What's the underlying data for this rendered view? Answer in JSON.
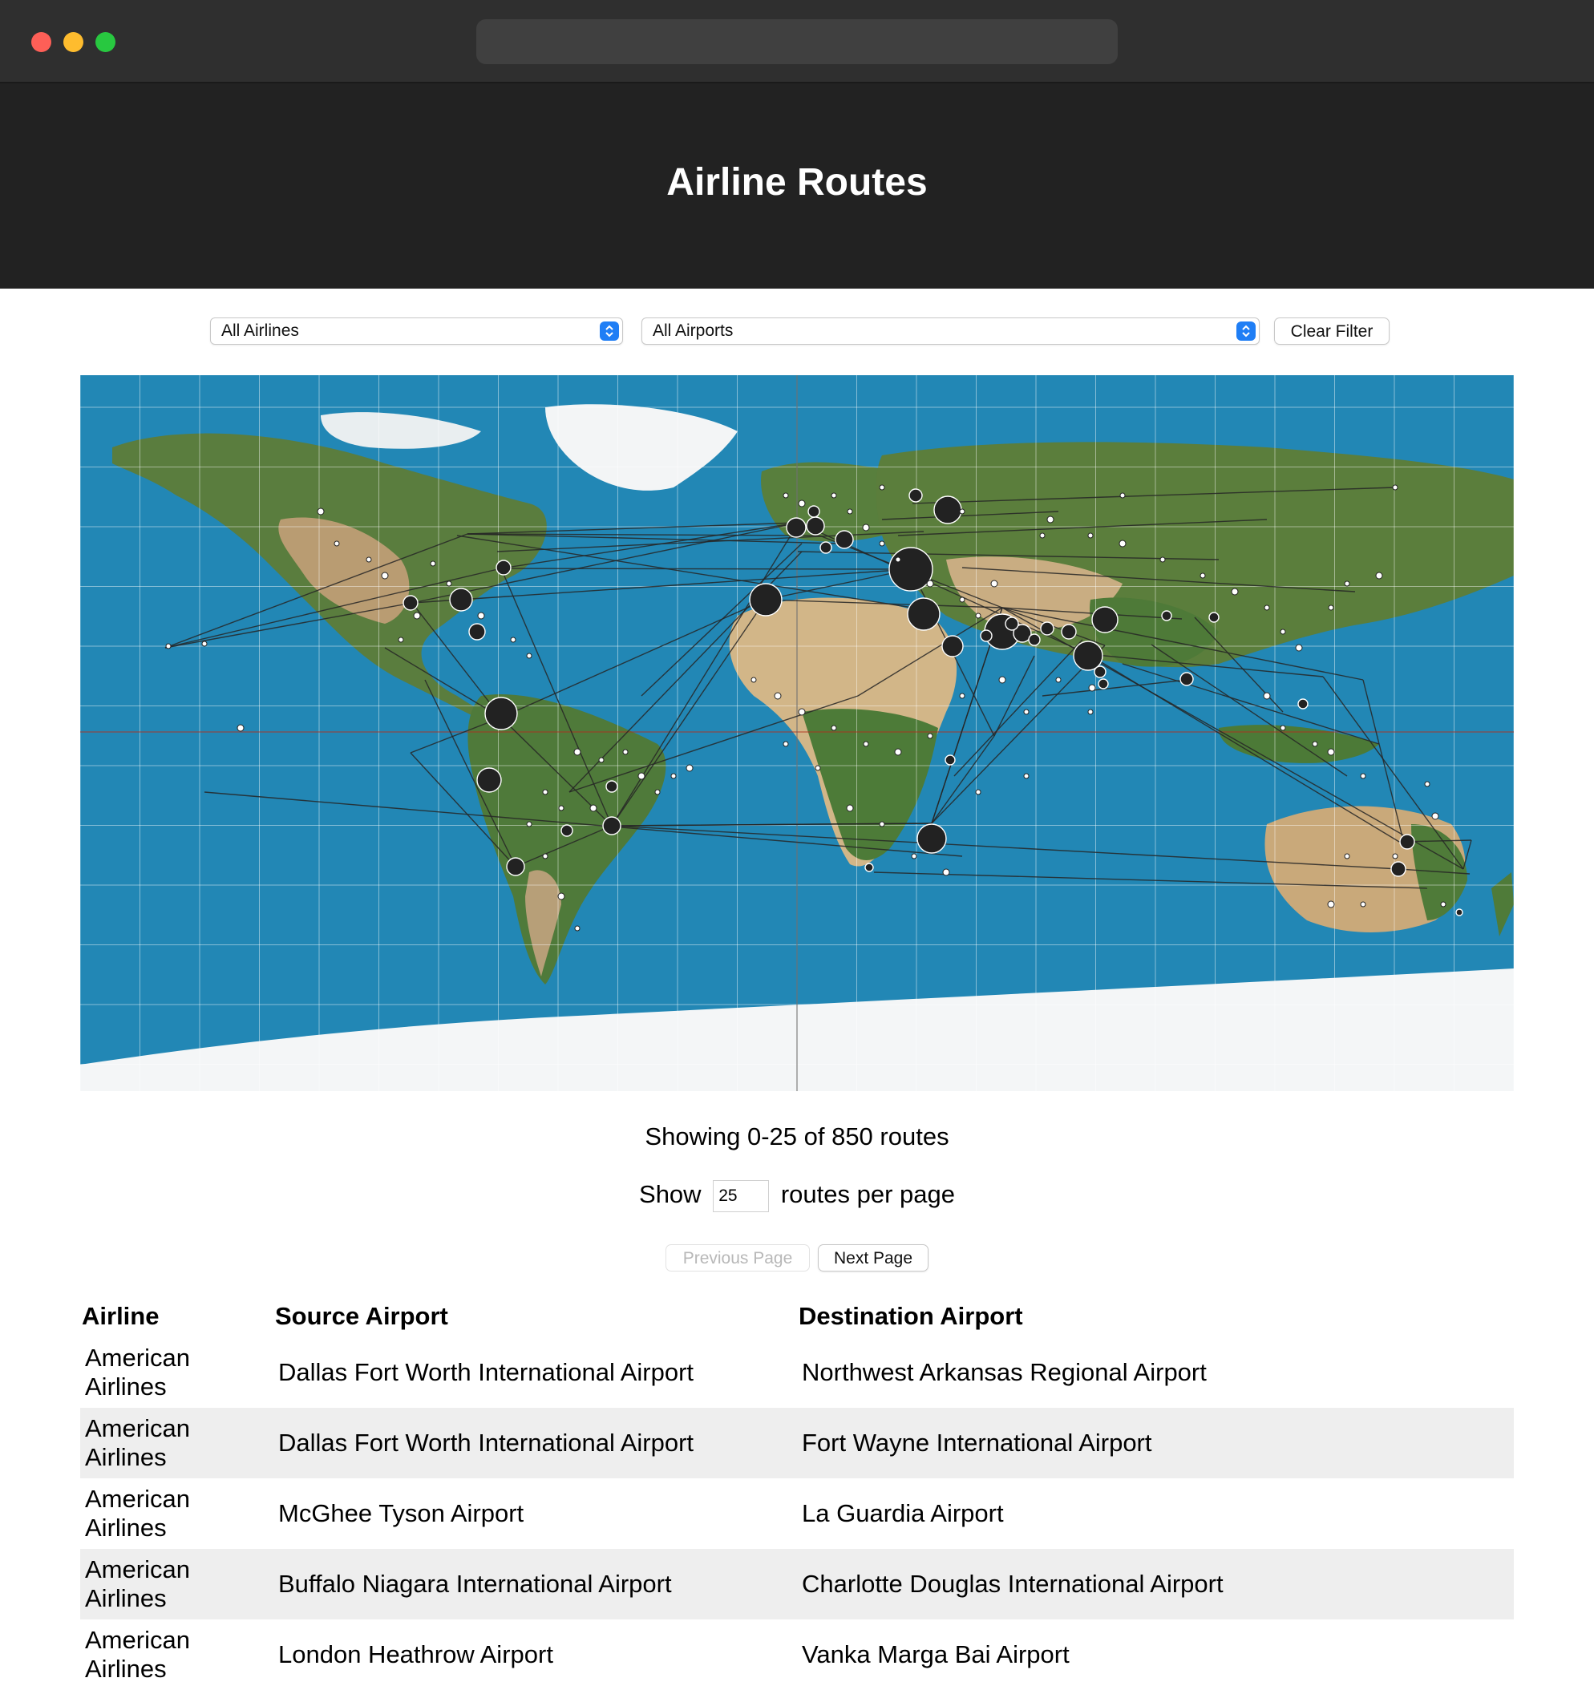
{
  "window": {
    "url": ""
  },
  "header": {
    "title": "Airline Routes"
  },
  "filters": {
    "airline_selected": "All Airlines",
    "airport_selected": "All Airports",
    "clear_label": "Clear Filter"
  },
  "map": {
    "colors": {
      "ocean": "#2287b5",
      "land_green": "#4f7a3a",
      "desert": "#cdb48c",
      "ice": "#f4f6f7",
      "route": "#2b2b2b",
      "hub": "#222222"
    }
  },
  "paging": {
    "showing_text": "Showing 0-25 of 850 routes",
    "show_label": "Show",
    "per_page": "25",
    "per_page_suffix": "routes per page",
    "prev_label": "Previous Page",
    "next_label": "Next Page"
  },
  "table": {
    "headers": {
      "airline": "Airline",
      "source": "Source Airport",
      "destination": "Destination Airport"
    },
    "rows": [
      {
        "airline": "American Airlines",
        "source": "Dallas Fort Worth International Airport",
        "destination": "Northwest Arkansas Regional Airport"
      },
      {
        "airline": "American Airlines",
        "source": "Dallas Fort Worth International Airport",
        "destination": "Fort Wayne International Airport"
      },
      {
        "airline": "American Airlines",
        "source": "McGhee Tyson Airport",
        "destination": "La Guardia Airport"
      },
      {
        "airline": "American Airlines",
        "source": "Buffalo Niagara International Airport",
        "destination": "Charlotte Douglas International Airport"
      },
      {
        "airline": "American Airlines",
        "source": "London Heathrow Airport",
        "destination": "Vanka Marga Bai Airport"
      }
    ]
  }
}
